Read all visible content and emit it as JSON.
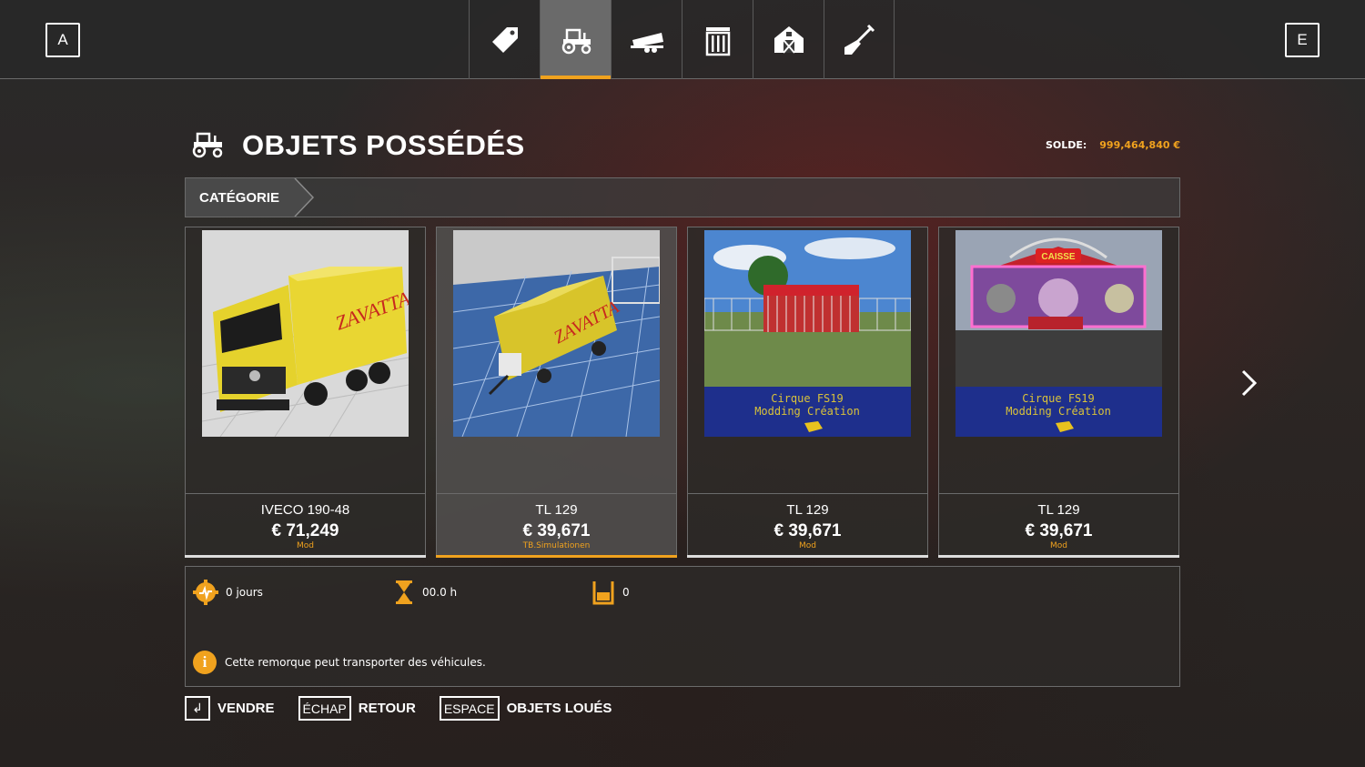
{
  "topbar": {
    "left_key": "A",
    "right_key": "E",
    "tabs": [
      {
        "icon": "price-tag-icon",
        "active": false
      },
      {
        "icon": "tractor-icon",
        "active": true
      },
      {
        "icon": "trailer-icon",
        "active": false
      },
      {
        "icon": "shed-icon",
        "active": false
      },
      {
        "icon": "barn-icon",
        "active": false
      },
      {
        "icon": "shovel-icon",
        "active": false
      }
    ]
  },
  "header": {
    "title": "OBJETS POSSÉDÉS",
    "balance_label": "SOLDE:",
    "balance_value": "999,464,840 €"
  },
  "category": {
    "label": "CATÉGORIE"
  },
  "items": [
    {
      "name": "IVECO 190-48",
      "price": "€ 71,249",
      "source": "Mod",
      "thumb": "yellow-truck-image"
    },
    {
      "name": "TL 129",
      "price": "€ 39,671",
      "source": "TB.Simulationen",
      "thumb": "yellow-trailer-image"
    },
    {
      "name": "TL 129",
      "price": "€ 39,671",
      "source": "Mod",
      "thumb": "circus-cages-image",
      "banner_line1": "Cirque FS19",
      "banner_line2": "Modding Création"
    },
    {
      "name": "TL 129",
      "price": "€ 39,671",
      "source": "Mod",
      "thumb": "circus-facade-image",
      "banner_line1": "Cirque FS19",
      "banner_line2": "Modding Création",
      "facade_sign": "CAISSE"
    }
  ],
  "details": {
    "age": "0 jours",
    "hours": "00.0 h",
    "fill": "0",
    "note": "Cette remorque peut transporter des véhicules."
  },
  "actions": [
    {
      "key": "↲",
      "label": "VENDRE"
    },
    {
      "key": "ÉCHAP",
      "label": "RETOUR"
    },
    {
      "key": "ESPACE",
      "label": "OBJETS LOUÉS"
    }
  ],
  "colors": {
    "accent": "#f0a21e",
    "panel": "#3c3c3c"
  }
}
